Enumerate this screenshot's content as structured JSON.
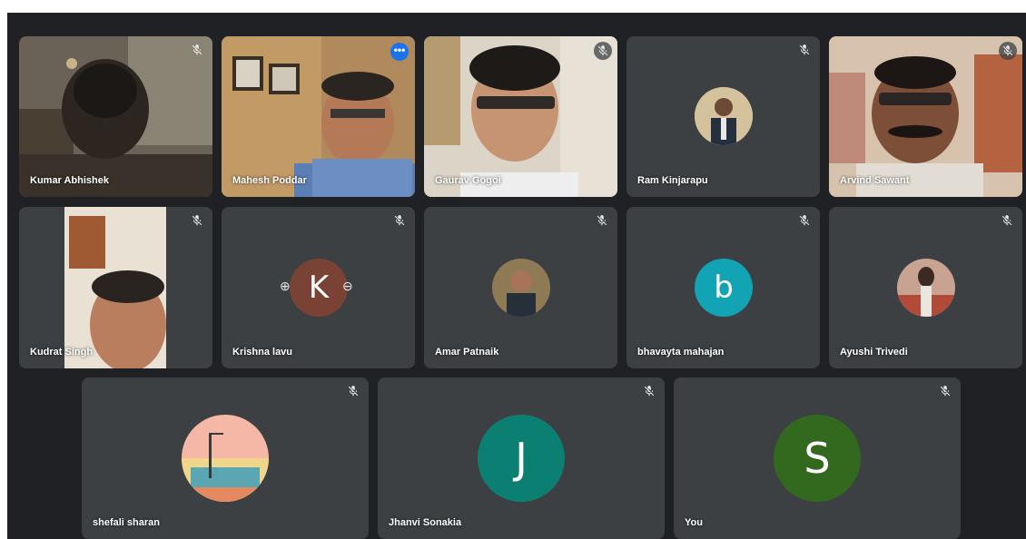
{
  "participants": {
    "kumar": {
      "name": "Kumar Abhishek"
    },
    "mahesh": {
      "name": "Mahesh Poddar",
      "more_glyph": "•••"
    },
    "gaurav": {
      "name": "Gaurav Gogoi"
    },
    "ram": {
      "name": "Ram Kinjarapu"
    },
    "arvind": {
      "name": "Arvind Sawant"
    },
    "kudrat": {
      "name": "Kudrat Singh"
    },
    "krishna": {
      "name": "Krishna lavu",
      "initial": "K",
      "pin_glyph": "⊕",
      "remove_glyph": "⊖"
    },
    "amar": {
      "name": "Amar Patnaik"
    },
    "bhavayta": {
      "name": "bhavayta mahajan",
      "initial": "b"
    },
    "ayushi": {
      "name": "Ayushi Trivedi"
    },
    "shefali": {
      "name": "shefali sharan"
    },
    "jhanvi": {
      "name": "Jhanvi Sonakia",
      "initial": "J"
    },
    "you": {
      "name": "You",
      "initial": "S"
    }
  },
  "colors": {
    "stage_bg": "#202124",
    "tile_bg": "#3c4043",
    "active_border": "#8ab4f8",
    "bhavayta_avatar": "#12a4b5",
    "jhanvi_avatar": "#0b8072",
    "you_avatar": "#33691e",
    "krishna_avatar": "#a1452d"
  },
  "icons": {
    "mute": "mic-off-icon",
    "more": "more-options-icon",
    "pin": "pin-icon",
    "remove": "remove-icon"
  }
}
